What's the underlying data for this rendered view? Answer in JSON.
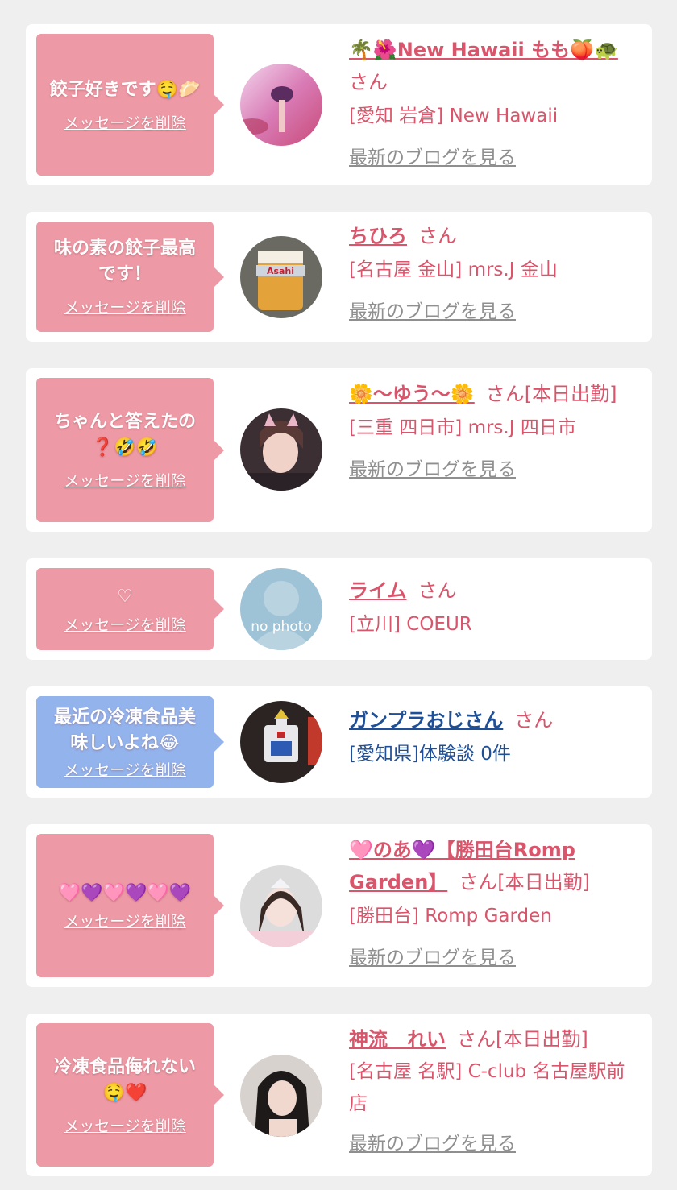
{
  "delete_label": "メッセージを削除",
  "blog_label": "最新のブログを見る",
  "san": "さん",
  "cards": [
    {
      "message": "餃子好きです🤤🥟",
      "name": "🌴🌺New Hawaii もも🍑🐢",
      "suffix": "さん",
      "shop": "[愛知 岩倉] New Hawaii",
      "has_blog": true
    },
    {
      "message": "味の素の餃子最高です！",
      "name": "ちひろ",
      "suffix": "さん",
      "shop": "[名古屋 金山] mrs.J 金山",
      "has_blog": true
    },
    {
      "message": "ちゃんと答えたの❓🤣🤣",
      "name": "🌼〜ゆう〜🌼",
      "suffix": "さん[本日出勤]",
      "shop": "[三重 四日市] mrs.J 四日市",
      "has_blog": true
    },
    {
      "message": "♡",
      "name": "ライム",
      "suffix": "さん",
      "shop": "[立川] COEUR",
      "avatar_text": "no photo",
      "has_blog": false
    },
    {
      "message": "最近の冷凍食品美味しいよね😂",
      "name": "ガンプラおじさん",
      "suffix": "さん",
      "shop": "[愛知県]体験談 0件",
      "has_blog": false
    },
    {
      "message": "🩷💜🩷💜🩷💜",
      "name": "🩷のあ💜【勝田台Romp Garden】",
      "suffix": "さん[本日出勤]",
      "shop": "[勝田台] Romp Garden",
      "has_blog": true
    },
    {
      "message": "冷凍食品侮れない🤤❤️",
      "name": "神流　れい",
      "suffix": "さん[本日出勤]",
      "shop": "[名古屋 名駅] C-club 名古屋駅前店",
      "has_blog": true
    }
  ],
  "colors": {
    "background": "#efefef",
    "card": "#ffffff",
    "bubble_pink": "#ee9aa6",
    "bubble_blue": "#93b3ec",
    "accent": "#d9556b",
    "male_text": "#1f4f96",
    "blog_link": "#8f8f8f"
  }
}
